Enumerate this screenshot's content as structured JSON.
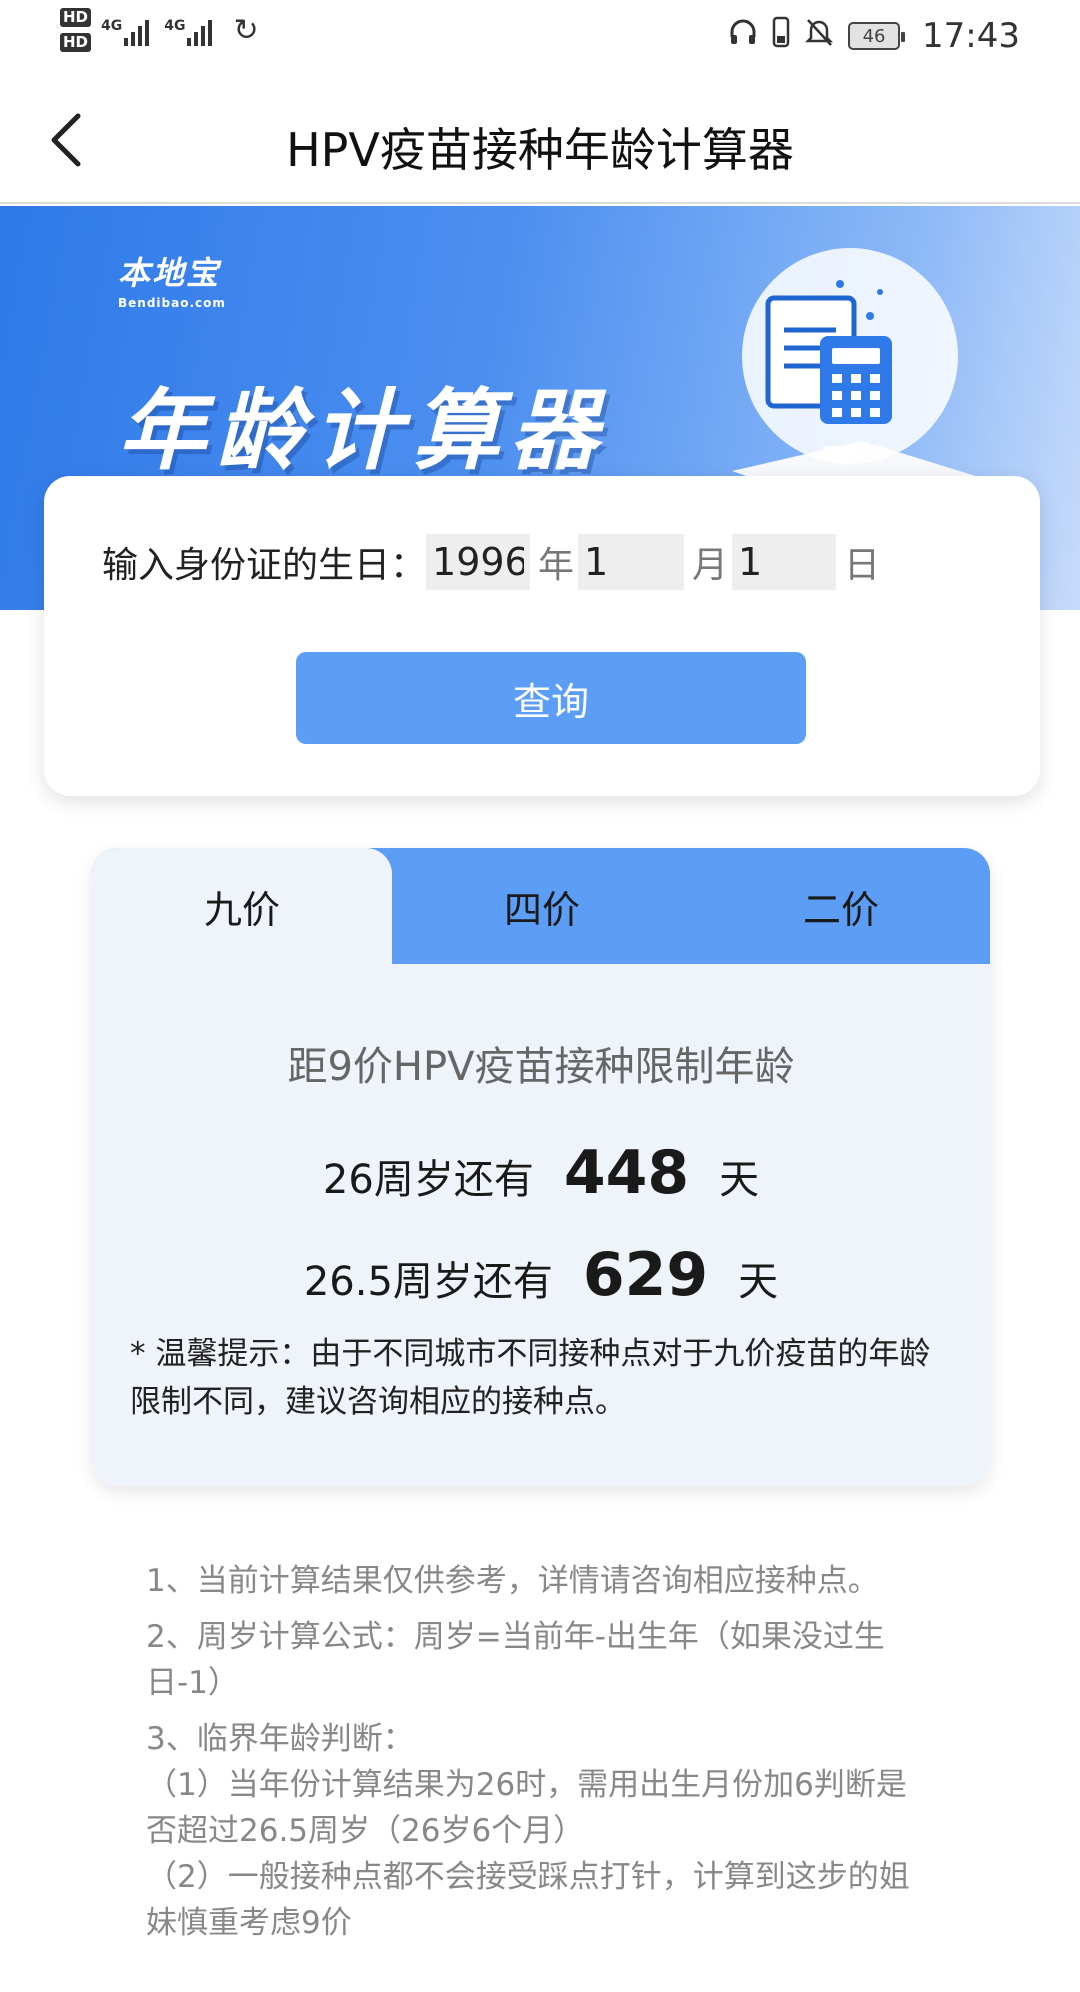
{
  "status_bar": {
    "hd1": "HD",
    "hd2": "HD",
    "sim1": "4G",
    "sim2": "4G",
    "battery": "46",
    "time": "17:43",
    "icons": [
      "headphones-icon",
      "phone-icon",
      "bell-off-icon",
      "wifi-sync-icon"
    ]
  },
  "header": {
    "title": "HPV疫苗接种年龄计算器",
    "back_icon": "chevron-left-icon"
  },
  "banner": {
    "logo_cn": "本地宝",
    "logo_en": "Bendibao.com",
    "title": "年龄计算器",
    "colors": {
      "start": "#2f7ae8",
      "end": "#c7dbfb"
    }
  },
  "query": {
    "label": "输入身份证的生日：",
    "year_value": "1996",
    "year_unit": "年",
    "month_value": "1",
    "month_unit": "月",
    "day_value": "1",
    "day_unit": "日",
    "button_label": "查询",
    "button_color": "#5c9df6"
  },
  "tabs": [
    {
      "label": "九价",
      "active": true
    },
    {
      "label": "四价",
      "active": false
    },
    {
      "label": "二价",
      "active": false
    }
  ],
  "result": {
    "heading": "距9价HPV疫苗接种限制年龄",
    "line1_label": "26周岁还有",
    "line1_value": "448",
    "line1_unit": "天",
    "line2_label": "26.5周岁还有",
    "line2_value": "629",
    "line2_unit": "天",
    "tip": "* 温馨提示：由于不同城市不同接种点对于九价疫苗的年龄限制不同，建议咨询相应的接种点。"
  },
  "notes": {
    "n1": "1、当前计算结果仅供参考，详情请咨询相应接种点。",
    "n2": "2、周岁计算公式：周岁=当前年-出生年（如果没过生日-1）",
    "n3": "3、临界年龄判断：",
    "n3a": "（1）当年份计算结果为26时，需用出生月份加6判断是否超过26.5周岁（26岁6个月）",
    "n3b": "（2）一般接种点都不会接受踩点打针，计算到这步的姐妹慎重考虑9价"
  }
}
